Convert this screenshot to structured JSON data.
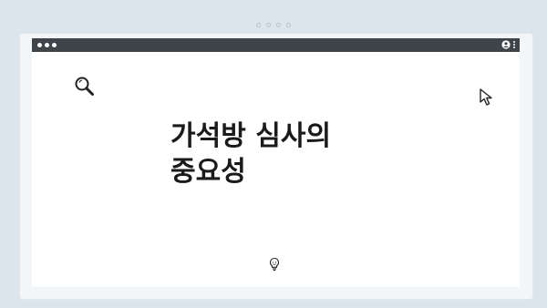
{
  "page": {
    "title": "가석방 심사의\n중요성"
  },
  "icons": {
    "top": "pagination-dots",
    "left": "search-icon",
    "right": "cursor-icon",
    "bottom": "lightbulb-icon",
    "user": "user-icon",
    "menu": "kebab-menu-icon"
  },
  "colors": {
    "background": "#dde5ec",
    "titlebar": "#3f4449",
    "card": "#ffffff",
    "text": "#1a1a1a"
  }
}
